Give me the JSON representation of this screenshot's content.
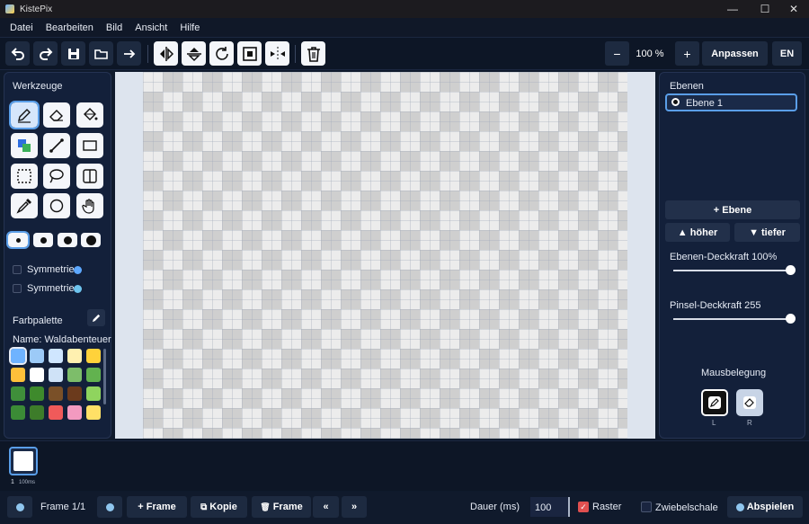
{
  "window": {
    "title": "KistePix",
    "minimize": "—",
    "maximize": "☐",
    "close": "✕"
  },
  "menu": [
    "Datei",
    "Bearbeiten",
    "Bild",
    "Ansicht",
    "Hilfe"
  ],
  "toolbar": {
    "zoom_minus": "−",
    "zoom_value": "100 %",
    "zoom_plus": "+",
    "fit_label": "Anpassen",
    "lang_label": "EN"
  },
  "tools": {
    "title": "Werkzeuge",
    "symmetry_labels": [
      "Symmetrie",
      "Symmetrie"
    ]
  },
  "palette": {
    "title": "Farbpalette",
    "name": "Name: Waldabenteuer",
    "colors": [
      "#6fb3ff",
      "#9ccaf7",
      "#cfe6ff",
      "#fff0b0",
      "#ffd23a",
      "#ffc03a",
      "#ffffff",
      "#cfe2f7",
      "#7dbd6a",
      "#62b24f",
      "#3f8f3a",
      "#3e8a2c",
      "#7a5028",
      "#6b3a1c",
      "#8fd45e",
      "#3b8b36",
      "#3d7c2a",
      "#f05a5a",
      "#f39ac0",
      "#ffe066"
    ]
  },
  "layers": {
    "title": "Ebenen",
    "items": [
      "Ebene 1"
    ],
    "add_label": "+ Ebene",
    "up_label": "▲ höher",
    "down_label": "▼ tiefer",
    "opacity_label": "Ebenen-Deckkraft 100%",
    "opacity_value": 1.0,
    "brush_opacity_label": "Pinsel-Deckkraft 255",
    "brush_opacity_value": 1.0,
    "mouse_title": "Mausbelegung",
    "mouse_left": "L",
    "mouse_right": "R"
  },
  "frames": {
    "thumb_index": "1",
    "thumb_duration": "100ms"
  },
  "bottombar": {
    "frame_label": "Frame 1/1",
    "add_frame": "+ Frame",
    "copy_frame": "Kopie",
    "delete_frame": "Frame",
    "first": "«",
    "last": "»",
    "duration_label": "Dauer (ms)",
    "duration_value": "100",
    "grid_label": "Raster",
    "grid_checked": true,
    "onion_label": "Zwiebelschale",
    "onion_checked": false,
    "play_label": "Abspielen"
  },
  "colors": {
    "accent": "#5a9ee8",
    "panel": "#13203a",
    "bg": "#0f1a2c"
  }
}
